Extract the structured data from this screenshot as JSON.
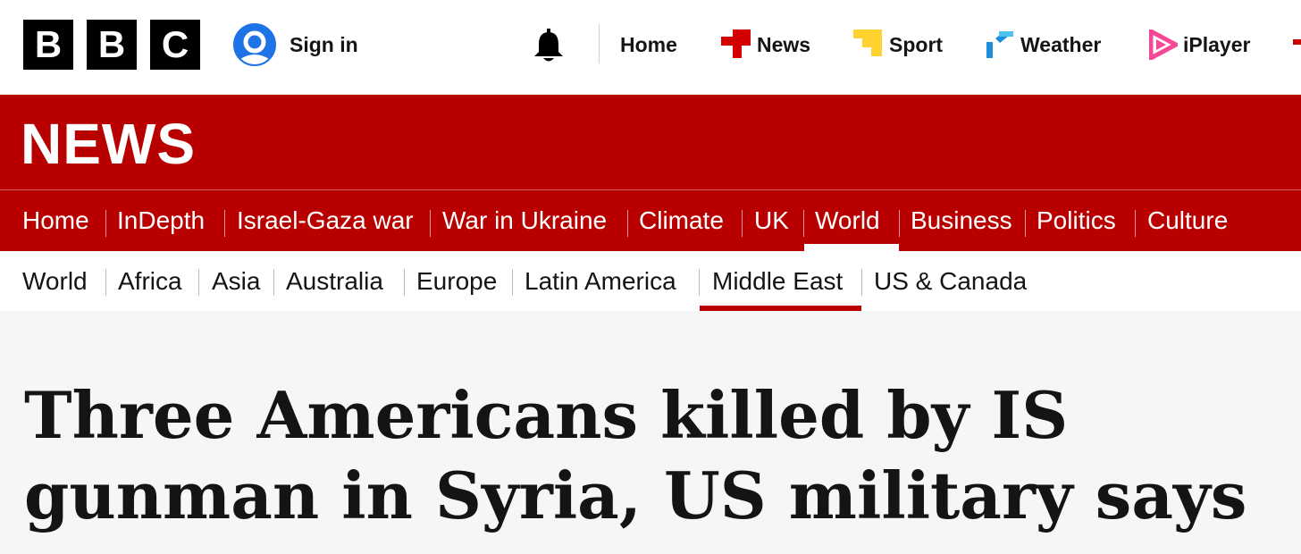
{
  "brand": {
    "letters": [
      "B",
      "B",
      "C"
    ]
  },
  "account": {
    "signin_label": "Sign in"
  },
  "topnav": {
    "items": [
      {
        "label": "Home",
        "icon": ""
      },
      {
        "label": "News",
        "icon": "news-icon"
      },
      {
        "label": "Sport",
        "icon": "sport-icon"
      },
      {
        "label": "Weather",
        "icon": "weather-icon"
      },
      {
        "label": "iPlayer",
        "icon": "iplayer-icon"
      }
    ]
  },
  "banner": {
    "title": "NEWS"
  },
  "sections": {
    "items": [
      "Home",
      "InDepth",
      "Israel-Gaza war",
      "War in Ukraine",
      "Climate",
      "UK",
      "World",
      "Business",
      "Politics",
      "Culture"
    ],
    "active": "World"
  },
  "subsections": {
    "items": [
      "World",
      "Africa",
      "Asia",
      "Australia",
      "Europe",
      "Latin America",
      "Middle East",
      "US & Canada"
    ],
    "active": "Middle East"
  },
  "article": {
    "headline_line1": "Three Americans killed by IS",
    "headline_line2": "gunman in Syria, US military says"
  },
  "colors": {
    "brand_red": "#b80000",
    "sport_yellow": "#ffd230",
    "weather_blue": "#1d8fd8",
    "iplayer_pink": "#f54997",
    "signin_blue": "#1e73e6"
  }
}
